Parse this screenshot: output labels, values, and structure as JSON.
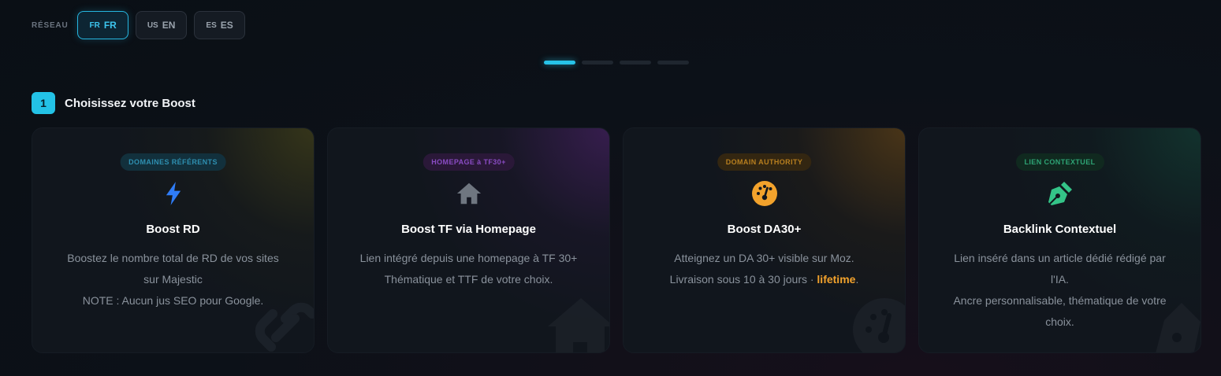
{
  "network": {
    "label": "RÉSEAU",
    "options": [
      {
        "flag": "FR",
        "code": "FR",
        "active": true
      },
      {
        "flag": "US",
        "code": "EN",
        "active": false
      },
      {
        "flag": "ES",
        "code": "ES",
        "active": false
      }
    ]
  },
  "progress": {
    "current_step": 1,
    "total_steps": 4
  },
  "step": {
    "number": "1",
    "title": "Choisissez votre Boost"
  },
  "cards": [
    {
      "badge": "DOMAINES RÉFÉRENTS",
      "icon": "lightning-icon",
      "title": "Boost RD",
      "lines": [
        "Boostez le nombre total de RD de vos sites",
        "sur Majestic",
        "NOTE : Aucun jus SEO pour Google."
      ]
    },
    {
      "badge": "HOMEPAGE à TF30+",
      "icon": "home-icon",
      "title": "Boost TF via Homepage",
      "lines": [
        "Lien intégré depuis une homepage à TF 30+",
        "Thématique et TTF de votre choix."
      ]
    },
    {
      "badge": "DOMAIN AUTHORITY",
      "icon": "gauge-icon",
      "title": "Boost DA30+",
      "lines": [
        "Atteignez un DA 30+ visible sur Moz."
      ],
      "line2_prefix": "Livraison sous 10 à 30 jours · ",
      "line2_highlight": "lifetime",
      "line2_suffix": "."
    },
    {
      "badge": "LIEN CONTEXTUEL",
      "icon": "pen-nib-icon",
      "title": "Backlink Contextuel",
      "lines": [
        "Lien inséré dans un article dédié rédigé par",
        "l'IA.",
        "Ancre personnalisable, thématique de votre",
        "choix."
      ]
    }
  ],
  "colors": {
    "accent": "#23c2e6",
    "lightning": "#2f7cf6",
    "home": "#6f7680",
    "gauge": "#f2a22c",
    "pen": "#34c488",
    "highlight": "#f2a22c"
  }
}
